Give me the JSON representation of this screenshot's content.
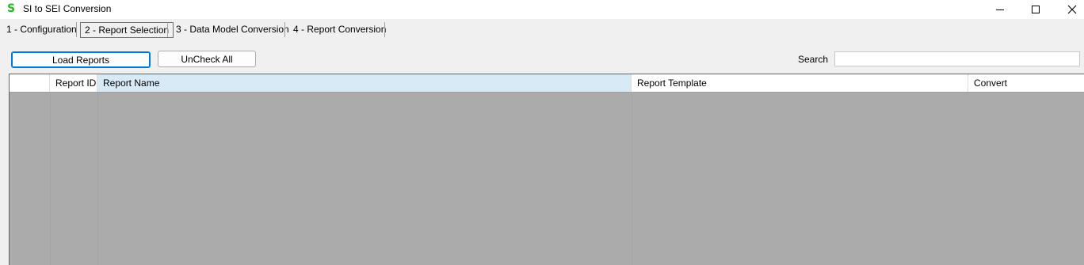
{
  "window": {
    "title": "SI to SEI Conversion",
    "app_icon_glyph": "S",
    "app_icon_color": "#1fbf1f"
  },
  "tabs": [
    {
      "label": "1 - Configuration",
      "selected": false
    },
    {
      "label": "2 - Report Selection",
      "selected": true
    },
    {
      "label": "3 - Data Model Conversion",
      "selected": false
    },
    {
      "label": "4 - Report Conversion",
      "selected": false
    }
  ],
  "toolbar": {
    "load_reports_label": "Load Reports",
    "uncheck_all_label": "UnCheck All",
    "search_label": "Search",
    "search_value": ""
  },
  "grid": {
    "columns": [
      "",
      "Report ID",
      "Report Name",
      "Report Template",
      "Convert"
    ],
    "rows": [],
    "background_color": "#ababab",
    "selected_header_color": "#d9eaf7"
  }
}
